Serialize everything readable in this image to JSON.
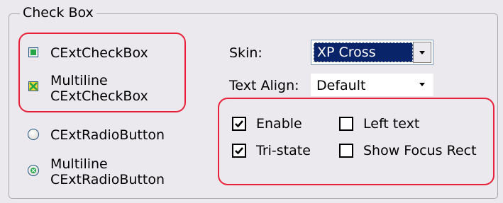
{
  "group": {
    "title": "Check Box"
  },
  "left_controls": {
    "check1": "CExtCheckBox",
    "check2_line1": "Multiline",
    "check2_line2": "CExtCheckBox",
    "radio1": "CExtRadioButton",
    "radio2_line1": "Multiline",
    "radio2_line2": "CExtRadioButton"
  },
  "skin": {
    "label": "Skin:",
    "value": "XP Cross",
    "selected": true
  },
  "text_align": {
    "label": "Text Align:",
    "value": "Default"
  },
  "options": [
    {
      "label": "Enable",
      "checked": true
    },
    {
      "label": "Tri-state",
      "checked": true
    },
    {
      "label": "Left text",
      "checked": false
    },
    {
      "label": "Show Focus Rect",
      "checked": false
    }
  ],
  "colors": {
    "highlight_red": "#e8213a",
    "selection_blue": "#0a246a",
    "check_green": "#22a447",
    "tristate_yellow": "#f5d53c"
  }
}
